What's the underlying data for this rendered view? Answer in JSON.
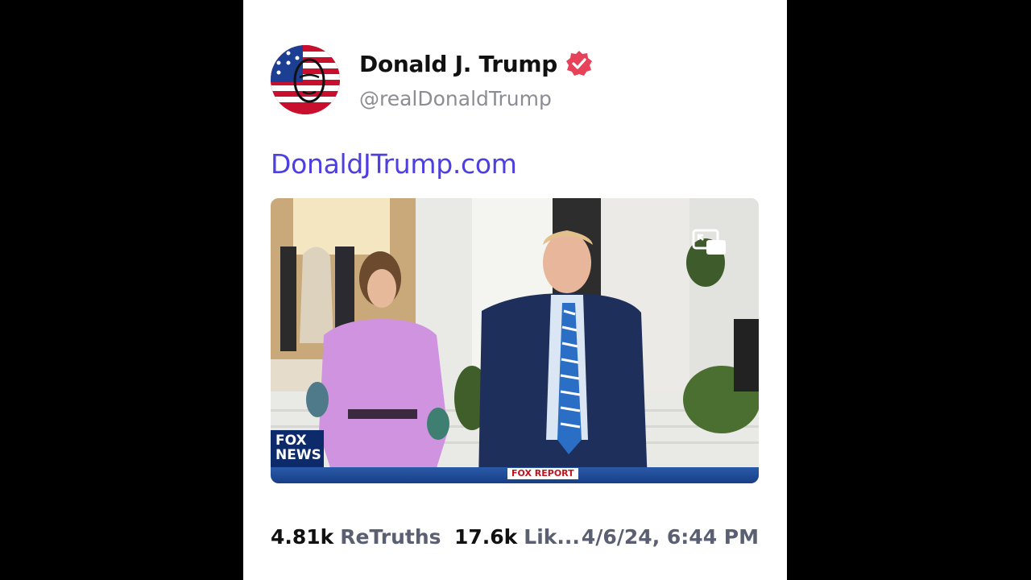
{
  "post": {
    "author_name": "Donald J. Trump",
    "handle": "@realDonaldTrump",
    "link_text": "DonaldJTrump.com",
    "verified_icon": "verified-badge-icon",
    "avatar": "flag-portrait-avatar",
    "accent_color": "#e8415a",
    "link_color": "#4d3fe0"
  },
  "video": {
    "network_logo": "FOX NEWS",
    "lower_third": "FOX REPORT",
    "pip_icon": "picture-in-picture-icon"
  },
  "stats": {
    "retruths_count": "4.81k",
    "retruths_label": "ReTruths",
    "likes_count": "17.6k",
    "likes_label": "Lik...",
    "timestamp": "4/6/24, 6:44 PM"
  }
}
